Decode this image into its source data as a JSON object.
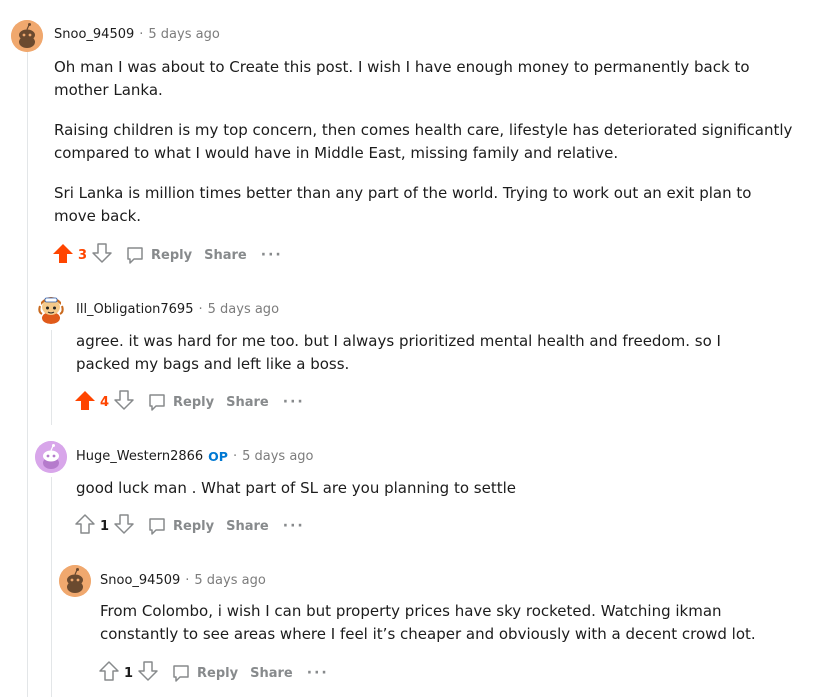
{
  "comments": [
    {
      "author": "Snoo_94509",
      "time": "5 days ago",
      "paragraphs": [
        "Oh man I was about to Create this post. I wish I have enough money to permanently back to mother Lanka.",
        "Raising children is my top concern, then comes health care, lifestyle has deteriorated significantly compared to what I would have in Middle East, missing family and relative.",
        "Sri Lanka is million times better than any part of the world. Trying to work out an exit plan to move back."
      ],
      "votes": "3",
      "upvoted": true,
      "reply_label": "Reply",
      "share_label": "Share",
      "more_label": "···",
      "avatar_color": "#f0a86e"
    },
    {
      "author": "Ill_Obligation7695",
      "time": "5 days ago",
      "paragraphs": [
        "agree. it was hard for me too. but I always prioritized mental health and freedom. so I packed my bags and left like a boss."
      ],
      "votes": "4",
      "upvoted": true,
      "reply_label": "Reply",
      "share_label": "Share",
      "more_label": "···",
      "avatar_color": "#e8a04a"
    },
    {
      "author": "Huge_Western2866",
      "op_badge": "OP",
      "time": "5 days ago",
      "paragraphs": [
        "good luck man . What part of SL are you planning to settle"
      ],
      "votes": "1",
      "upvoted": false,
      "reply_label": "Reply",
      "share_label": "Share",
      "more_label": "···",
      "avatar_color": "#d8a6ea"
    },
    {
      "author": "Snoo_94509",
      "time": "5 days ago",
      "paragraphs": [
        "From Colombo, i wish I can but property prices have sky rocketed. Watching ikman constantly to see areas where I feel it’s cheaper and obviously with a decent crowd lot."
      ],
      "votes": "1",
      "upvoted": false,
      "reply_label": "Reply",
      "share_label": "Share",
      "more_label": "···",
      "avatar_color": "#f0a86e"
    }
  ],
  "meta_separator": "·",
  "colors": {
    "upvote": "#ff4500",
    "op": "#0079d3",
    "muted": "#878a8c"
  }
}
